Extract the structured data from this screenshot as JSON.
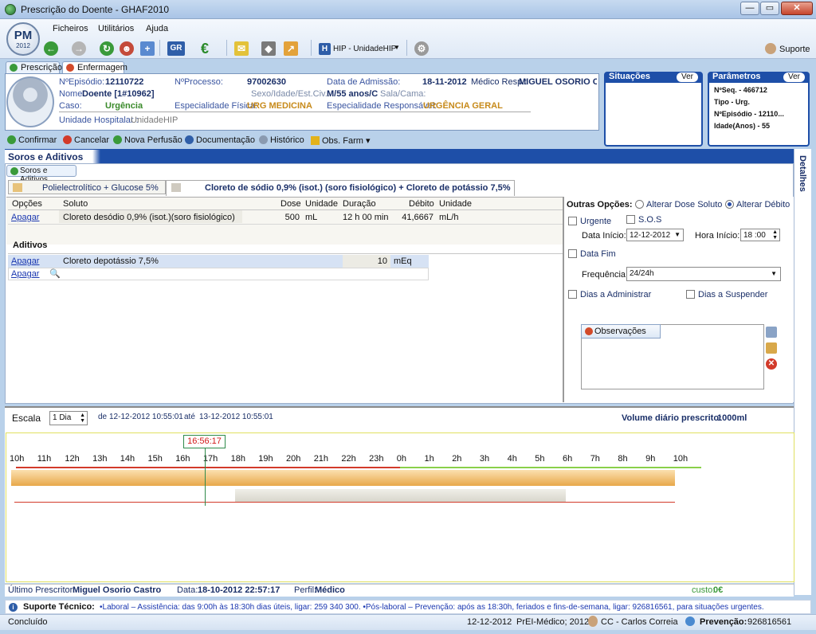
{
  "window": {
    "title": "Prescrição do Doente - GHAF2010",
    "minimize": "—",
    "maximize": "▭",
    "close": "✕"
  },
  "logo": {
    "text": "PM",
    "year": "2012"
  },
  "menu": {
    "items": [
      "Ficheiros",
      "Utilitários",
      "Ajuda"
    ]
  },
  "toolbar": {
    "unit_label": "HIP - UnidadeHIP",
    "support_label": "Suporte"
  },
  "tabs": {
    "prescricao": "Prescrição",
    "enfermagem": "Enfermagem"
  },
  "patient": {
    "episodio_label": "NºEpisódio:",
    "episodio": "12110722",
    "processo_label": "NºProcesso:",
    "processo": "97002630",
    "admissao_label": "Data de Admissão:",
    "admissao": "18-11-2012",
    "medico_label": "Médico Resp.:",
    "medico": "MIGUEL OSORIO CAS",
    "nome_label": "Nome:",
    "nome": "Doente [1#10962]",
    "sexo_label": "Sexo/Idade/Est.Civ.:",
    "sexo": "M/55 anos/C",
    "sala_label": "Sala/Cama:",
    "caso_label": "Caso:",
    "caso": "Urgência",
    "esp_fisica_label": "Especialidade Física:",
    "esp_fisica": "URG MEDICINA",
    "esp_resp_label": "Especialidade Responsável:",
    "esp_resp": "URGÊNCIA GERAL",
    "unidade_label": "Unidade Hospitalar :",
    "unidade": "UnidadeHIP"
  },
  "situacoes": {
    "title": "Situações",
    "ver": "Ver"
  },
  "parametros": {
    "title": "Parâmetros",
    "ver": "Ver",
    "items": [
      "NºSeq. - 466712",
      "Tipo - Urg.",
      "NºEpisódio - 12110...",
      "Idade(Anos) - 55"
    ]
  },
  "actions": {
    "confirmar": "Confirmar",
    "cancelar": "Cancelar",
    "nova_perfusao": "Nova Perfusão",
    "documentacao": "Documentação",
    "historico": "Histórico",
    "obs_farm": "Obs. Farm"
  },
  "section": {
    "title": "Soros e Aditivos",
    "subtab": "Soros e Aditivos",
    "detalhes": "Detalhes"
  },
  "solution_tabs": [
    "Polielectrolítico + Glucose 5%",
    "Cloreto de sódio 0,9%  (isot.) (soro fisiológico) + Cloreto de potássio 7,5%"
  ],
  "soluto_grid": {
    "headers": [
      "Opções",
      "Soluto",
      "Dose",
      "Unidade",
      "Duração",
      "Débito",
      "Unidade"
    ],
    "row": {
      "opcao": "Apagar",
      "soluto": "Cloreto desódio 0,9% (isot.)(soro fisiológico)",
      "dose": "500",
      "unidade": "mL",
      "duracao": "12 h 00 min",
      "debito": "41,6667",
      "unidade_debito": "mL/h"
    }
  },
  "aditivos": {
    "title": "Aditivos",
    "rows": [
      {
        "opcao": "Apagar",
        "nome": "Cloreto depotássio 7,5%",
        "dose": "10",
        "unidade": "mEq"
      },
      {
        "opcao": "Apagar",
        "nome": "",
        "dose": "",
        "unidade": ""
      }
    ]
  },
  "outras_opcoes": {
    "title": "Outras Opções:",
    "alterar_dose": "Alterar Dose Soluto",
    "alterar_debito": "Alterar Débito",
    "urgente": "Urgente",
    "sos": "S.O.S",
    "data_inicio_label": "Data Início:",
    "data_inicio": "12-12-2012",
    "hora_inicio_label": "Hora Início:",
    "hora_inicio": "18 :00",
    "data_fim": "Data Fim",
    "frequencia_label": "Frequência:",
    "frequencia": "24/24h",
    "dias_administrar": "Dias a Administrar",
    "dias_suspender": "Dias a Suspender",
    "observacoes": "Observações"
  },
  "timeline": {
    "escala_label": "Escala",
    "escala": "1 Dia",
    "de_label": "de",
    "de": "12-12-2012 10:55:01",
    "ate_label": "até",
    "ate": "13-12-2012 10:55:01",
    "volume_label": "Volume diário prescrito:",
    "volume": "1000ml",
    "now": "16:56:17",
    "hours": [
      "10h",
      "11h",
      "12h",
      "13h",
      "14h",
      "15h",
      "16h",
      "17h",
      "18h",
      "19h",
      "20h",
      "21h",
      "22h",
      "23h",
      "0h",
      "1h",
      "2h",
      "3h",
      "4h",
      "5h",
      "6h",
      "7h",
      "8h",
      "9h",
      "10h"
    ]
  },
  "footer": {
    "prescritor_label": "Último Prescritor:",
    "prescritor": "Miguel Osorio Castro",
    "data_label": "Data:",
    "data": "18-10-2012 22:57:17",
    "perfil_label": "Perfil:",
    "perfil": "Médico",
    "custo_label": "custo:",
    "custo": "0€",
    "suporte_label": "Suporte Técnico:",
    "suporte_text": "•Laboral – Assistência: das 9:00h às 18:30h dias úteis, ligar: 259 340 300. •Pós-laboral – Prevenção: após as 18:30h, feriados e fins-de-semana, ligar: 926816561, para situações urgentes.",
    "status": "Concluído",
    "date": "12-12-2012",
    "profile": "PrEI-Médico; 2012",
    "user": "CC - Carlos Correia",
    "prevencao_label": "Prevenção:",
    "prevencao": "926816561"
  }
}
